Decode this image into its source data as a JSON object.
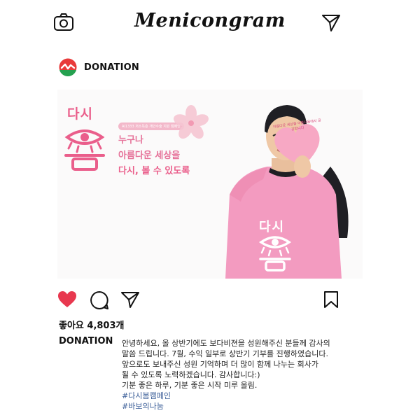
{
  "app": {
    "name": "Menicongram"
  },
  "account": {
    "name": "DONATION"
  },
  "post": {
    "title_top": "다시",
    "title_bottom": "봄",
    "mini_label": "AI1333 저소득층 개안수술 지원 캠페인",
    "slogan": [
      "누구나",
      "아름다운 세상을",
      "다시, 볼 수 있도록"
    ],
    "bubble_text": "아름다운 세상을 아름다움에서 공감합니다",
    "shirt_text": "다시"
  },
  "likes": {
    "text": "좋아요 4,803개"
  },
  "caption": {
    "username": "DONATION",
    "lines": [
      "안녕하세요, 올 상반기에도 보다비젼을 성원해주신 분들께 감사의",
      "말씀 드립니다. 7월, 수익 일부로 상반기 기부를 진행하였습니다.",
      "앞으로도 보내주신 성원 기억하며 더 많이 함께 나누는 회사가",
      "될 수 있도록 노력하겠습니다. 감사합니다:)",
      "기분 좋은 하루, 기분 좋은 시작 미루 올림."
    ],
    "hashtags": [
      "#다시봄캠페인",
      "#바보의나눔"
    ]
  },
  "colors": {
    "pink": "#ea5e8b",
    "heart": "#e8384f",
    "hashtag": "#3b5e98"
  },
  "icons": [
    "camera-icon",
    "send-icon",
    "heart-icon",
    "comment-icon",
    "share-icon",
    "bookmark-icon"
  ]
}
